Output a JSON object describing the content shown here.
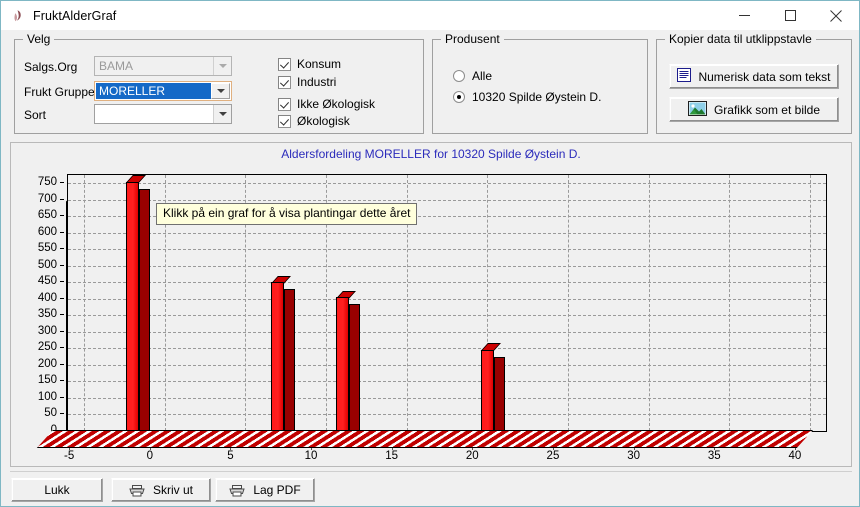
{
  "window": {
    "title": "FruktAlderGraf",
    "icon": "app-icon",
    "minimize": "–",
    "maximize": "□",
    "close": "✕"
  },
  "velg_group": {
    "legend": "Velg",
    "fields": [
      {
        "label": "Salgs.Org",
        "value": "BAMA",
        "placeholder": "",
        "state": "disabled"
      },
      {
        "label": "Frukt Gruppe",
        "value": "MORELLER",
        "placeholder": "",
        "state": "focused"
      },
      {
        "label": "Sort",
        "value": "",
        "placeholder": "",
        "state": "normal"
      }
    ],
    "checkboxes": [
      {
        "label": "Konsum",
        "checked": true
      },
      {
        "label": "Industri",
        "checked": true
      },
      {
        "label": "Ikke Økologisk",
        "checked": true
      },
      {
        "label": "Økologisk",
        "checked": true
      }
    ]
  },
  "produsent_group": {
    "legend": "Produsent",
    "options": [
      {
        "label": "Alle",
        "checked": false
      },
      {
        "label": "10320 Spilde Øystein D.",
        "checked": true
      }
    ]
  },
  "kopier_group": {
    "legend": "Kopier data til utklippstavle",
    "buttons": [
      {
        "label": "Numerisk data som tekst",
        "icon": "text-document-icon"
      },
      {
        "label": "Grafikk som et bilde",
        "icon": "picture-icon"
      }
    ]
  },
  "bottom_buttons": [
    {
      "label": "Lukk",
      "icon": ""
    },
    {
      "label": "Skriv ut",
      "icon": "printer-icon"
    },
    {
      "label": "Lag PDF",
      "icon": "printer-icon"
    }
  ],
  "chart_tooltip": "Klikk på ein graf for å visa plantingar dette året",
  "colors": {
    "title": "#2b2bbb",
    "bar_front": "#ff2020",
    "bar_side": "#990000",
    "bar_top": "#cc0000",
    "wall": "#fbf5a8",
    "floor_stripe": "#c00000",
    "tooltip_bg": "#ffffdc",
    "selection": "#1569c7",
    "window_bg": "#f0f0f0"
  },
  "chart_data": {
    "type": "bar",
    "title": "Aldersfordeling MORELLER for 10320 Spilde Øystein D.",
    "xlabel": "",
    "ylabel": "",
    "x": [
      -2,
      7,
      11,
      20
    ],
    "values": [
      755,
      450,
      405,
      245
    ],
    "categories": [
      "-2",
      "7",
      "11",
      "20"
    ],
    "xlim": [
      -6,
      41
    ],
    "ylim": [
      0,
      775
    ],
    "xticks": [
      -5,
      0,
      5,
      10,
      15,
      20,
      25,
      30,
      35,
      40
    ],
    "xtick_labels": [
      "-5",
      "0",
      "5",
      "10",
      "15",
      "20",
      "25",
      "30",
      "35",
      "40"
    ],
    "yticks": [
      0,
      50,
      100,
      150,
      200,
      250,
      300,
      350,
      400,
      450,
      500,
      550,
      600,
      650,
      700,
      750
    ],
    "ytick_labels": [
      "0",
      "50",
      "100",
      "150",
      "200",
      "250",
      "300",
      "350",
      "400",
      "450",
      "500",
      "550",
      "600",
      "650",
      "700",
      "750"
    ],
    "grid": true,
    "legend": "none",
    "style": "3d-bar"
  }
}
